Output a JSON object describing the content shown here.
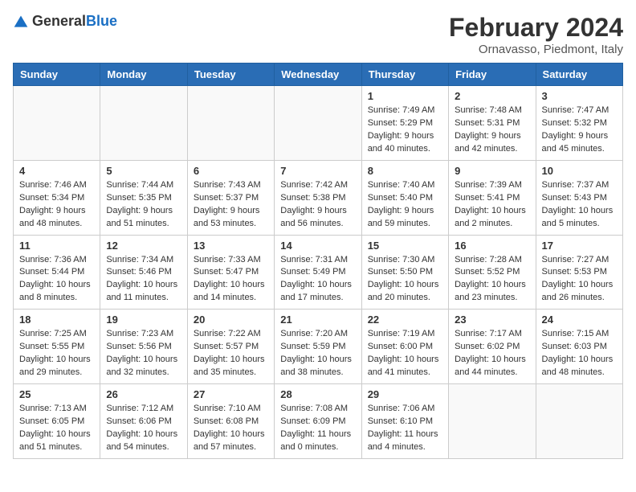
{
  "header": {
    "logo_general": "General",
    "logo_blue": "Blue",
    "month_year": "February 2024",
    "location": "Ornavasso, Piedmont, Italy"
  },
  "weekdays": [
    "Sunday",
    "Monday",
    "Tuesday",
    "Wednesday",
    "Thursday",
    "Friday",
    "Saturday"
  ],
  "weeks": [
    [
      {
        "day": "",
        "info": ""
      },
      {
        "day": "",
        "info": ""
      },
      {
        "day": "",
        "info": ""
      },
      {
        "day": "",
        "info": ""
      },
      {
        "day": "1",
        "info": "Sunrise: 7:49 AM\nSunset: 5:29 PM\nDaylight: 9 hours\nand 40 minutes."
      },
      {
        "day": "2",
        "info": "Sunrise: 7:48 AM\nSunset: 5:31 PM\nDaylight: 9 hours\nand 42 minutes."
      },
      {
        "day": "3",
        "info": "Sunrise: 7:47 AM\nSunset: 5:32 PM\nDaylight: 9 hours\nand 45 minutes."
      }
    ],
    [
      {
        "day": "4",
        "info": "Sunrise: 7:46 AM\nSunset: 5:34 PM\nDaylight: 9 hours\nand 48 minutes."
      },
      {
        "day": "5",
        "info": "Sunrise: 7:44 AM\nSunset: 5:35 PM\nDaylight: 9 hours\nand 51 minutes."
      },
      {
        "day": "6",
        "info": "Sunrise: 7:43 AM\nSunset: 5:37 PM\nDaylight: 9 hours\nand 53 minutes."
      },
      {
        "day": "7",
        "info": "Sunrise: 7:42 AM\nSunset: 5:38 PM\nDaylight: 9 hours\nand 56 minutes."
      },
      {
        "day": "8",
        "info": "Sunrise: 7:40 AM\nSunset: 5:40 PM\nDaylight: 9 hours\nand 59 minutes."
      },
      {
        "day": "9",
        "info": "Sunrise: 7:39 AM\nSunset: 5:41 PM\nDaylight: 10 hours\nand 2 minutes."
      },
      {
        "day": "10",
        "info": "Sunrise: 7:37 AM\nSunset: 5:43 PM\nDaylight: 10 hours\nand 5 minutes."
      }
    ],
    [
      {
        "day": "11",
        "info": "Sunrise: 7:36 AM\nSunset: 5:44 PM\nDaylight: 10 hours\nand 8 minutes."
      },
      {
        "day": "12",
        "info": "Sunrise: 7:34 AM\nSunset: 5:46 PM\nDaylight: 10 hours\nand 11 minutes."
      },
      {
        "day": "13",
        "info": "Sunrise: 7:33 AM\nSunset: 5:47 PM\nDaylight: 10 hours\nand 14 minutes."
      },
      {
        "day": "14",
        "info": "Sunrise: 7:31 AM\nSunset: 5:49 PM\nDaylight: 10 hours\nand 17 minutes."
      },
      {
        "day": "15",
        "info": "Sunrise: 7:30 AM\nSunset: 5:50 PM\nDaylight: 10 hours\nand 20 minutes."
      },
      {
        "day": "16",
        "info": "Sunrise: 7:28 AM\nSunset: 5:52 PM\nDaylight: 10 hours\nand 23 minutes."
      },
      {
        "day": "17",
        "info": "Sunrise: 7:27 AM\nSunset: 5:53 PM\nDaylight: 10 hours\nand 26 minutes."
      }
    ],
    [
      {
        "day": "18",
        "info": "Sunrise: 7:25 AM\nSunset: 5:55 PM\nDaylight: 10 hours\nand 29 minutes."
      },
      {
        "day": "19",
        "info": "Sunrise: 7:23 AM\nSunset: 5:56 PM\nDaylight: 10 hours\nand 32 minutes."
      },
      {
        "day": "20",
        "info": "Sunrise: 7:22 AM\nSunset: 5:57 PM\nDaylight: 10 hours\nand 35 minutes."
      },
      {
        "day": "21",
        "info": "Sunrise: 7:20 AM\nSunset: 5:59 PM\nDaylight: 10 hours\nand 38 minutes."
      },
      {
        "day": "22",
        "info": "Sunrise: 7:19 AM\nSunset: 6:00 PM\nDaylight: 10 hours\nand 41 minutes."
      },
      {
        "day": "23",
        "info": "Sunrise: 7:17 AM\nSunset: 6:02 PM\nDaylight: 10 hours\nand 44 minutes."
      },
      {
        "day": "24",
        "info": "Sunrise: 7:15 AM\nSunset: 6:03 PM\nDaylight: 10 hours\nand 48 minutes."
      }
    ],
    [
      {
        "day": "25",
        "info": "Sunrise: 7:13 AM\nSunset: 6:05 PM\nDaylight: 10 hours\nand 51 minutes."
      },
      {
        "day": "26",
        "info": "Sunrise: 7:12 AM\nSunset: 6:06 PM\nDaylight: 10 hours\nand 54 minutes."
      },
      {
        "day": "27",
        "info": "Sunrise: 7:10 AM\nSunset: 6:08 PM\nDaylight: 10 hours\nand 57 minutes."
      },
      {
        "day": "28",
        "info": "Sunrise: 7:08 AM\nSunset: 6:09 PM\nDaylight: 11 hours\nand 0 minutes."
      },
      {
        "day": "29",
        "info": "Sunrise: 7:06 AM\nSunset: 6:10 PM\nDaylight: 11 hours\nand 4 minutes."
      },
      {
        "day": "",
        "info": ""
      },
      {
        "day": "",
        "info": ""
      }
    ]
  ]
}
